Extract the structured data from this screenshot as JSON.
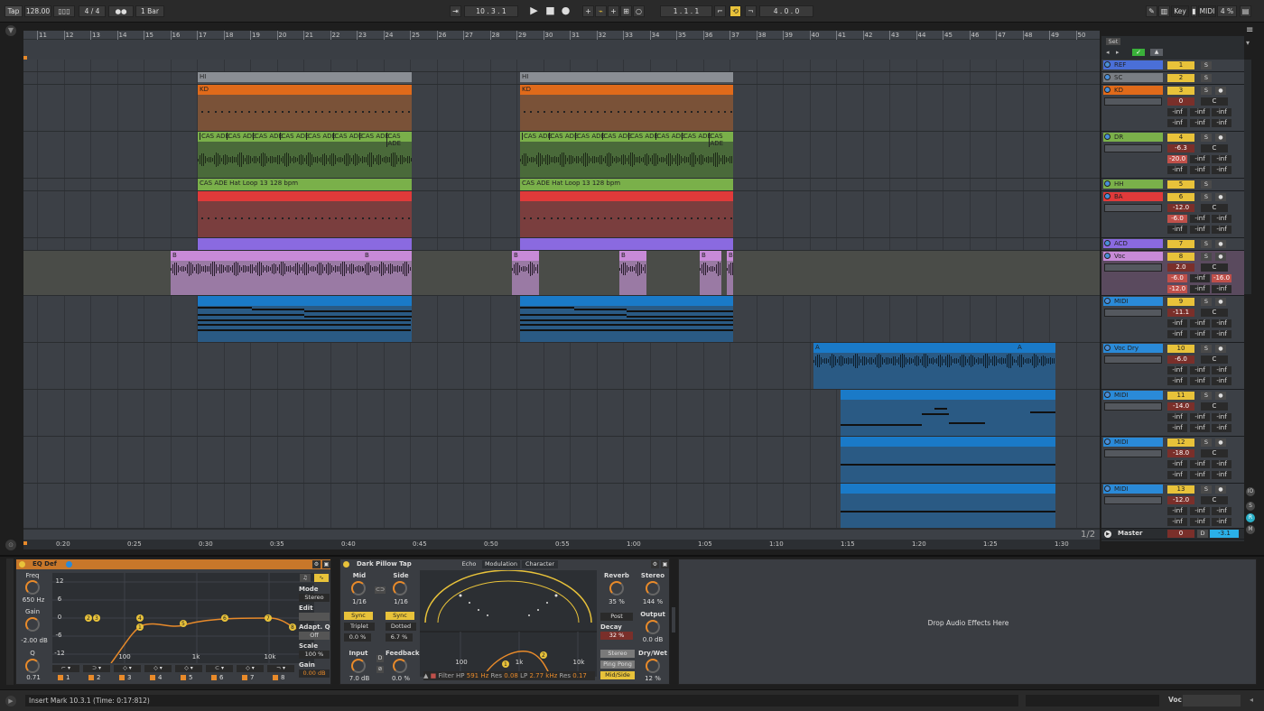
{
  "transport": {
    "tap": "Tap",
    "tempo": "128.00",
    "time_sig_num": "4",
    "time_sig_den": "4",
    "metronome": "●",
    "quantize": "1 Bar",
    "position": "10 .  3 .  1",
    "loop_start": "1 .  1 .  1",
    "loop_length": "4 .  0 .  0",
    "key": "Key",
    "midi": "MIDI",
    "cpu": "4 %"
  },
  "ruler_bars": [
    "11",
    "12",
    "13",
    "14",
    "15",
    "16",
    "17",
    "18",
    "19",
    "20",
    "21",
    "22",
    "23",
    "24",
    "25",
    "26",
    "27",
    "28",
    "29",
    "30",
    "31",
    "32",
    "33",
    "34",
    "35",
    "36",
    "37",
    "38",
    "39",
    "40",
    "41",
    "42",
    "43",
    "44",
    "45",
    "46",
    "47",
    "48",
    "49",
    "50"
  ],
  "time_ticks": [
    "0:20",
    "0:25",
    "0:30",
    "0:35",
    "0:40",
    "0:45",
    "0:50",
    "0:55",
    "1:00",
    "1:05",
    "1:10",
    "1:15",
    "1:20",
    "1:25",
    "1:30"
  ],
  "page_indicator": "1/2",
  "set_label": "Set",
  "clips": {
    "hi1": "HI",
    "hi2": "HI",
    "kd1": "KD",
    "kd2": "KD",
    "dr_chop": "CAS ADE",
    "hat1": "CAS ADE Hat Loop 13 128 bpm",
    "hat2": "CAS ADE Hat Loop 13 128 bpm",
    "voc_b": "B",
    "voc_a": "A"
  },
  "tracks": [
    {
      "name": "REF",
      "num": "1",
      "color": "#4a6fd8",
      "type": "small"
    },
    {
      "name": "SC",
      "num": "2",
      "color": "#7a7e84",
      "type": "small"
    },
    {
      "name": "KD",
      "num": "3",
      "color": "#e06a1a",
      "type": "big",
      "vol": "0",
      "pan": "C",
      "meters": [
        "-inf",
        "-inf",
        "-inf",
        "-inf"
      ]
    },
    {
      "name": "DR",
      "num": "4",
      "color": "#7ab04a",
      "type": "big",
      "vol": "-6.3",
      "pan": "C",
      "meters": [
        "-20.0",
        "-inf",
        "-inf",
        "-inf"
      ]
    },
    {
      "name": "HH",
      "num": "5",
      "color": "#7ab04a",
      "type": "small"
    },
    {
      "name": "BA",
      "num": "6",
      "color": "#e03a3a",
      "type": "big",
      "vol": "-12.0",
      "pan": "C",
      "meters": [
        "-6.0",
        "-inf",
        "-inf",
        "-inf"
      ]
    },
    {
      "name": "ACD",
      "num": "7",
      "color": "#8a6ae0",
      "type": "small"
    },
    {
      "name": "Voc",
      "num": "8",
      "color": "#c88ad8",
      "type": "big",
      "vol": "2.0",
      "pan": "C",
      "meters": [
        "-6.0",
        "-inf",
        "-16.0",
        "-12.0"
      ]
    },
    {
      "name": "MIDI",
      "num": "9",
      "color": "#2a8ad8",
      "type": "big",
      "vol": "-11.1",
      "pan": "C",
      "meters": [
        "-inf",
        "-inf",
        "-inf",
        "-inf"
      ]
    },
    {
      "name": "Voc Dry",
      "num": "10",
      "color": "#2a8ad8",
      "type": "big",
      "vol": "-6.0",
      "pan": "C",
      "meters": [
        "-inf",
        "-inf",
        "-inf",
        "-inf"
      ]
    },
    {
      "name": "MIDI",
      "num": "11",
      "color": "#2a8ad8",
      "type": "big",
      "vol": "-14.0",
      "pan": "C",
      "meters": [
        "-inf",
        "-inf",
        "-inf",
        "-inf"
      ]
    },
    {
      "name": "MIDI",
      "num": "12",
      "color": "#2a8ad8",
      "type": "big",
      "vol": "-18.0",
      "pan": "C",
      "meters": [
        "-inf",
        "-inf",
        "-inf",
        "-inf"
      ]
    },
    {
      "name": "MIDI",
      "num": "13",
      "color": "#2a8ad8",
      "type": "big",
      "vol": "-12.0",
      "pan": "C",
      "meters": [
        "-inf",
        "-inf",
        "-inf",
        "-inf"
      ]
    }
  ],
  "master": {
    "name": "Master",
    "vol": "0",
    "pan": "-3.1"
  },
  "eq": {
    "title": "EQ Def",
    "freq_label": "Freq",
    "freq": "650 Hz",
    "gain_label": "Gain",
    "gain": "-2.00 dB",
    "q_label": "Q",
    "q": "0.71",
    "db_ticks": [
      "12",
      "6",
      "0",
      "-6",
      "-12"
    ],
    "freq_ticks": [
      "100",
      "1k",
      "10k"
    ],
    "mode_label": "Mode",
    "mode": "Stereo",
    "edit_label": "Edit",
    "adapt_label": "Adapt. Q",
    "adapt": "Off",
    "scale_label": "Scale",
    "scale": "100 %",
    "gain2_label": "Gain",
    "gain2": "0.00 dB",
    "bands": [
      "1",
      "2",
      "3",
      "4",
      "5",
      "6",
      "7",
      "8"
    ]
  },
  "pillow": {
    "title": "Dark Pillow Tap",
    "tabs": [
      "Echo",
      "Modulation",
      "Character"
    ],
    "mid_label": "Mid",
    "mid": "1/16",
    "side_label": "Side",
    "side": "1/16",
    "sync": "Sync",
    "triplet": "Triplet",
    "triplet_val": "0.0 %",
    "dotted": "Dotted",
    "dotted_val": "6.7 %",
    "input_label": "Input",
    "input": "7.0 dB",
    "feedback_label": "Feedback",
    "feedback": "0.0 %",
    "filter_text": "Filter HP",
    "hp": "591 Hz",
    "res1_label": "Res",
    "res1": "0.08",
    "lp_label": "LP",
    "lp": "2.77 kHz",
    "res2_label": "Res",
    "res2": "0.17",
    "freq_ticks": [
      "100",
      "1k",
      "10k"
    ],
    "reverb_label": "Reverb",
    "reverb": "35 %",
    "stereo_label": "Stereo",
    "stereo": "144 %",
    "post": "Post",
    "output_label": "Output",
    "output": "0.0 dB",
    "decay_label": "Decay",
    "decay": "32 %",
    "drywet_label": "Dry/Wet",
    "drywet": "12 %",
    "stereo_btn": "Stereo",
    "pingpong": "Ping Pong",
    "midside": "Mid/Side"
  },
  "drop_text": "Drop Audio Effects Here",
  "status": {
    "message": "Insert Mark 10.3.1 (Time: 0:17:812)",
    "track": "Voc"
  }
}
